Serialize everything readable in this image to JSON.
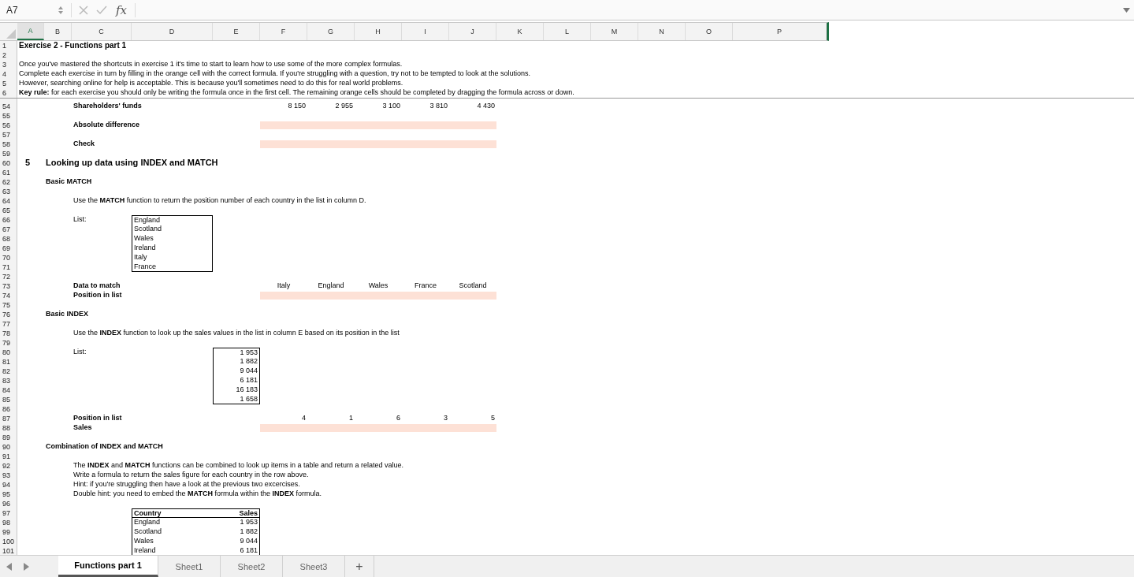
{
  "formula_bar": {
    "name_box": "A7",
    "function_label": "fx"
  },
  "columns": [
    {
      "label": "A",
      "selected": true
    },
    {
      "label": "B",
      "selected": false
    },
    {
      "label": "C",
      "selected": false
    },
    {
      "label": "D",
      "selected": false
    },
    {
      "label": "E",
      "selected": false
    },
    {
      "label": "F",
      "selected": false
    },
    {
      "label": "G",
      "selected": false
    },
    {
      "label": "H",
      "selected": false
    },
    {
      "label": "I",
      "selected": false
    },
    {
      "label": "J",
      "selected": false
    },
    {
      "label": "K",
      "selected": false
    },
    {
      "label": "L",
      "selected": false
    },
    {
      "label": "M",
      "selected": false
    },
    {
      "label": "N",
      "selected": false
    },
    {
      "label": "O",
      "selected": false
    },
    {
      "label": "P",
      "selected": false
    }
  ],
  "frozen_rows": [
    {
      "n": "1",
      "A": {
        "kind": "title",
        "text": "Exercise 2 - Functions part 1"
      }
    },
    {
      "n": "2"
    },
    {
      "n": "3",
      "A": {
        "kind": "text",
        "text": "Once you've mastered the shortcuts in exercise 1 it's time to start to learn how to use some of the more complex formulas."
      }
    },
    {
      "n": "4",
      "A": {
        "kind": "text",
        "text": "Complete each exercise in turn by filling in the orange cell with the correct formula. If you're struggling with a question, try not to be tempted to look at the solutions."
      }
    },
    {
      "n": "5",
      "A": {
        "kind": "text",
        "text": "However, searching online for help is acceptable. This is because you'll sometimes need to do this for real world problems."
      }
    },
    {
      "n": "6",
      "A": {
        "kind": "text",
        "text": "**Key rule:** for each exercise you should only be writing the formula once in the first cell. The remaining orange cells should be completed by dragging the formula across or down."
      }
    }
  ],
  "rows": [
    {
      "n": "54",
      "C": {
        "kind": "label",
        "text": "Shareholders' funds"
      },
      "F": {
        "kind": "number",
        "text": "8 150"
      },
      "G": {
        "kind": "number",
        "text": "2 955"
      },
      "H": {
        "kind": "number",
        "text": "3 100"
      },
      "I": {
        "kind": "number",
        "text": "3 810"
      },
      "J": {
        "kind": "number",
        "text": "4 430"
      }
    },
    {
      "n": "55"
    },
    {
      "n": "56",
      "C": {
        "kind": "label",
        "text": "Absolute difference"
      },
      "F": {
        "kind": "input"
      },
      "G": {
        "kind": "input"
      },
      "H": {
        "kind": "input"
      },
      "I": {
        "kind": "input"
      },
      "J": {
        "kind": "input"
      }
    },
    {
      "n": "57"
    },
    {
      "n": "58",
      "C": {
        "kind": "label",
        "text": "Check"
      },
      "F": {
        "kind": "input"
      },
      "G": {
        "kind": "input"
      },
      "H": {
        "kind": "input"
      },
      "I": {
        "kind": "input"
      },
      "J": {
        "kind": "input"
      }
    },
    {
      "n": "59"
    },
    {
      "n": "60",
      "A": {
        "kind": "section",
        "text": "5"
      },
      "B": {
        "kind": "heading",
        "text": "Looking up data using INDEX and MATCH"
      }
    },
    {
      "n": "61"
    },
    {
      "n": "62",
      "B": {
        "kind": "label",
        "text": "Basic MATCH"
      }
    },
    {
      "n": "63"
    },
    {
      "n": "64",
      "C": {
        "kind": "text",
        "text": "Use the **MATCH** function to return the position number of each country in the list in column D."
      }
    },
    {
      "n": "65"
    },
    {
      "n": "66",
      "C": {
        "kind": "text",
        "text": "List:"
      },
      "D": {
        "kind": "text",
        "text": "England",
        "boxed": true
      }
    },
    {
      "n": "67",
      "D": {
        "kind": "text",
        "text": "Scotland",
        "boxed": true
      }
    },
    {
      "n": "68",
      "D": {
        "kind": "text",
        "text": "Wales",
        "boxed": true
      }
    },
    {
      "n": "69",
      "D": {
        "kind": "text",
        "text": "Ireland",
        "boxed": true
      }
    },
    {
      "n": "70",
      "D": {
        "kind": "text",
        "text": "Italy",
        "boxed": true
      }
    },
    {
      "n": "71",
      "D": {
        "kind": "text",
        "text": "France",
        "boxed": true
      }
    },
    {
      "n": "72"
    },
    {
      "n": "73",
      "C": {
        "kind": "label",
        "text": "Data to match"
      },
      "F": {
        "kind": "value",
        "text": "Italy"
      },
      "G": {
        "kind": "value",
        "text": "England"
      },
      "H": {
        "kind": "value",
        "text": "Wales"
      },
      "I": {
        "kind": "value",
        "text": "France"
      },
      "J": {
        "kind": "value",
        "text": "Scotland"
      }
    },
    {
      "n": "74",
      "C": {
        "kind": "label",
        "text": "Position in list"
      },
      "F": {
        "kind": "input"
      },
      "G": {
        "kind": "input"
      },
      "H": {
        "kind": "input"
      },
      "I": {
        "kind": "input"
      },
      "J": {
        "kind": "input"
      }
    },
    {
      "n": "75"
    },
    {
      "n": "76",
      "B": {
        "kind": "label",
        "text": "Basic INDEX"
      }
    },
    {
      "n": "77"
    },
    {
      "n": "78",
      "C": {
        "kind": "text",
        "text": "Use the **INDEX** function to look up the sales values in the list in column E based on its position in the list"
      }
    },
    {
      "n": "79"
    },
    {
      "n": "80",
      "C": {
        "kind": "text",
        "text": "List:"
      },
      "E": {
        "kind": "number",
        "text": "1 953",
        "boxed": true
      }
    },
    {
      "n": "81",
      "E": {
        "kind": "number",
        "text": "1 882",
        "boxed": true
      }
    },
    {
      "n": "82",
      "E": {
        "kind": "number",
        "text": "9 044",
        "boxed": true
      }
    },
    {
      "n": "83",
      "E": {
        "kind": "number",
        "text": "6 181",
        "boxed": true
      }
    },
    {
      "n": "84",
      "E": {
        "kind": "number",
        "text": "16 183",
        "boxed": true
      }
    },
    {
      "n": "85",
      "E": {
        "kind": "number",
        "text": "1 658",
        "boxed": true
      }
    },
    {
      "n": "86"
    },
    {
      "n": "87",
      "C": {
        "kind": "label",
        "text": "Position in list"
      },
      "F": {
        "kind": "number",
        "text": "4"
      },
      "G": {
        "kind": "number",
        "text": "1"
      },
      "H": {
        "kind": "number",
        "text": "6"
      },
      "I": {
        "kind": "number",
        "text": "3"
      },
      "J": {
        "kind": "number",
        "text": "5"
      }
    },
    {
      "n": "88",
      "C": {
        "kind": "label",
        "text": "Sales"
      },
      "F": {
        "kind": "input"
      },
      "G": {
        "kind": "input"
      },
      "H": {
        "kind": "input"
      },
      "I": {
        "kind": "input"
      },
      "J": {
        "kind": "input"
      }
    },
    {
      "n": "89"
    },
    {
      "n": "90",
      "B": {
        "kind": "label",
        "text": "Combination of INDEX and MATCH"
      }
    },
    {
      "n": "91"
    },
    {
      "n": "92",
      "C": {
        "kind": "text",
        "text": "The **INDEX** and **MATCH** functions can be combined to look up items in a table and return a related value."
      }
    },
    {
      "n": "93",
      "C": {
        "kind": "text",
        "text": "Write a formula to return the sales figure for each country in the row above."
      }
    },
    {
      "n": "94",
      "C": {
        "kind": "text",
        "text": "Hint: if you're struggling then have a look at the previous two excercises."
      }
    },
    {
      "n": "95",
      "C": {
        "kind": "text",
        "text": "Double hint: you need to embed the **MATCH** formula within the **INDEX** formula."
      }
    },
    {
      "n": "96"
    },
    {
      "n": "97",
      "D": {
        "kind": "header",
        "text": "Country",
        "boxed": true
      },
      "E": {
        "kind": "number_header",
        "text": "Sales",
        "boxed": true
      }
    },
    {
      "n": "98",
      "D": {
        "kind": "text",
        "text": "England",
        "boxed": true
      },
      "E": {
        "kind": "number",
        "text": "1 953",
        "boxed": true
      }
    },
    {
      "n": "99",
      "D": {
        "kind": "text",
        "text": "Scotland",
        "boxed": true
      },
      "E": {
        "kind": "number",
        "text": "1 882",
        "boxed": true
      }
    },
    {
      "n": "100",
      "D": {
        "kind": "text",
        "text": "Wales",
        "boxed": true
      },
      "E": {
        "kind": "number",
        "text": "9 044",
        "boxed": true
      }
    },
    {
      "n": "101",
      "D": {
        "kind": "text",
        "text": "Ireland",
        "boxed": true
      },
      "E": {
        "kind": "number",
        "text": "6 181",
        "boxed": true
      }
    }
  ],
  "sheet_tabs": [
    {
      "label": "Functions part 1",
      "selected": true
    },
    {
      "label": "Sheet1",
      "selected": false
    },
    {
      "label": "Sheet2",
      "selected": false
    },
    {
      "label": "Sheet3",
      "selected": false
    }
  ],
  "add_sheet": "+"
}
